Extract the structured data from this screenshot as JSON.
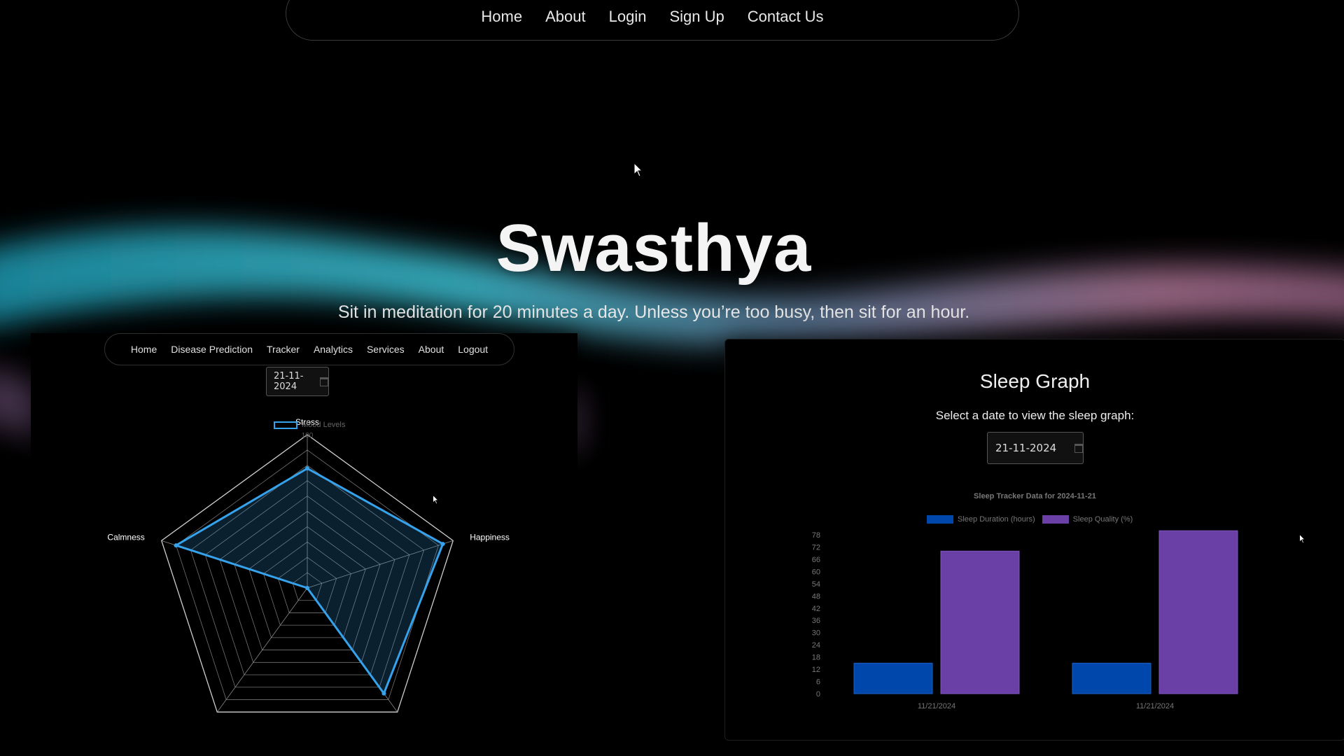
{
  "top_nav": {
    "items": [
      "Home",
      "About",
      "Login",
      "Sign Up",
      "Contact Us"
    ]
  },
  "hero": {
    "title": "Swasthya",
    "quote": "Sit in meditation for 20 minutes a day. Unless you’re too busy, then sit for an hour."
  },
  "mood_window": {
    "nav": [
      "Home",
      "Disease Prediction",
      "Tracker",
      "Analytics",
      "Services",
      "About",
      "Logout"
    ],
    "date_value": "21-11-2024",
    "legend": "Mood Levels"
  },
  "sleep_window": {
    "title": "Sleep Graph",
    "select_label": "Select a date to view the sleep graph:",
    "date_value": "21-11-2024",
    "chart_title": "Sleep Tracker Data for 2024-11-21",
    "legend_duration": "Sleep Duration (hours)",
    "legend_quality": "Sleep Quality (%)"
  },
  "colors": {
    "accent_blue": "#36a2eb",
    "duration_bar": "#0047ab",
    "quality_bar": "#6a3fa6"
  },
  "chart_data": [
    {
      "type": "radar",
      "series": [
        {
          "name": "Mood Levels",
          "values": [
            78,
            93,
            85,
            0,
            90
          ]
        }
      ],
      "categories": [
        "Stress",
        "Happiness",
        "",
        "",
        "Calmness"
      ],
      "rlim": [
        0,
        100
      ],
      "tick_label": "100"
    },
    {
      "type": "bar",
      "title": "Sleep Tracker Data for 2024-11-21",
      "categories": [
        "11/21/2024",
        "11/21/2024"
      ],
      "series": [
        {
          "name": "Sleep Duration (hours)",
          "values": [
            15,
            15
          ]
        },
        {
          "name": "Sleep Quality (%)",
          "values": [
            70,
            80
          ]
        }
      ],
      "yticks": [
        "0",
        "6",
        "12",
        "18",
        "24",
        "30",
        "36",
        "42",
        "48",
        "54",
        "60",
        "66",
        "72",
        "78"
      ],
      "ylim": [
        0,
        78
      ]
    }
  ]
}
